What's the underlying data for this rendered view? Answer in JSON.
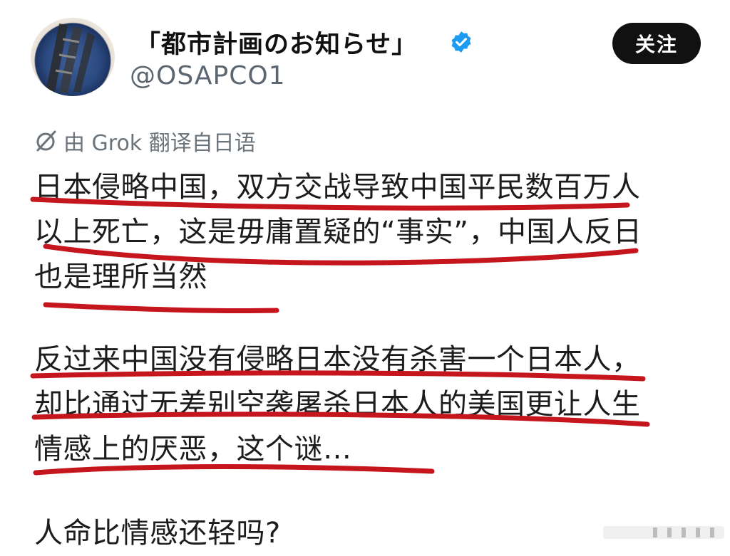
{
  "account": {
    "display_name": "「都市計画のお知らせ」",
    "handle": "@OSAPCO1",
    "follow_label": "关注"
  },
  "translation": {
    "label": "由 Grok 翻译自日语"
  },
  "post": {
    "paragraph_1": "日本侵略中国，双方交战导致中国平民数百万人\n以上死亡，这是毋庸置疑的“事实”，中国人反日\n也是理所当然",
    "paragraph_2": "反过来中国没有侵略日本没有杀害一个日本人，\n却比通过无差别空袭屠杀日本人的美国更让人生\n情感上的厌恶，这个谜…",
    "paragraph_3": "人命比情感还轻吗?"
  },
  "colors": {
    "underline": "#c4161c",
    "verified": "#1d9bf0",
    "follow_bg": "#111111"
  },
  "icons": {
    "verified": "verified-badge-icon",
    "translate": "grok-icon"
  }
}
